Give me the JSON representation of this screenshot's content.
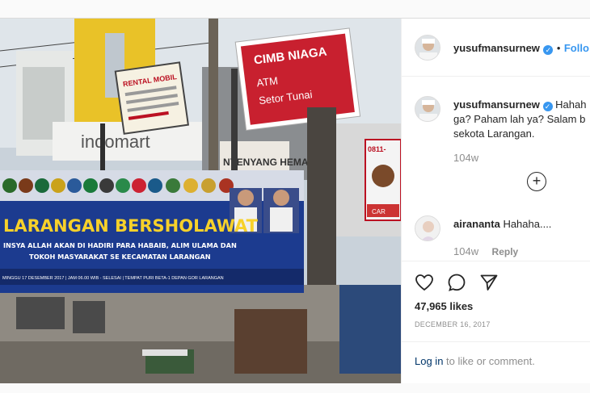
{
  "post": {
    "author": "yusufmansurnew",
    "follow_label": "Follo",
    "caption_lines": [
      "Hahah",
      "ga? Paham lah ya? Salam b",
      "sekota Larangan."
    ],
    "caption_age": "104w",
    "comment": {
      "author": "airananta",
      "text": "Hahaha....",
      "age": "104w",
      "reply_label": "Reply"
    },
    "likes": "47,965 likes",
    "date": "DECEMBER 16, 2017",
    "login_link": "Log in",
    "login_rest": " to like or comment."
  },
  "photo": {
    "sign_cimb_title": "CIMB NIAGA",
    "sign_cimb_line1": "ATM",
    "sign_cimb_line2": "Setor Tunai",
    "sign_rental": "RENTAL MOBIL",
    "sign_indomart": "indomart",
    "sign_hemat": "NYENYANG HEMAT",
    "banner_title": "LARANGAN BERSHOLAWAT",
    "banner_line1": "INSYA ALLAH AKAN DI HADIRI PARA HABAIB, ALIM ULAMA DAN",
    "banner_line2": "TOKOH MASYARAKAT SE KECAMATAN LARANGAN",
    "banner_footer": "MINGGU 17 DESEMBER 2017 | JAM 06.00 WIB - SELESAI | TEMPAT PURI BETA-1 DEPAN GOR LARANGAN",
    "pole_sign": "0811-",
    "pole_sign_bottom": "CAR"
  },
  "colors": {
    "accent": "#3897f0",
    "banner_blue": "#1c3b8f",
    "cimb_red": "#c8202f"
  },
  "icons": [
    "verified-badge",
    "add-icon",
    "heart-icon",
    "comment-icon",
    "share-icon"
  ]
}
